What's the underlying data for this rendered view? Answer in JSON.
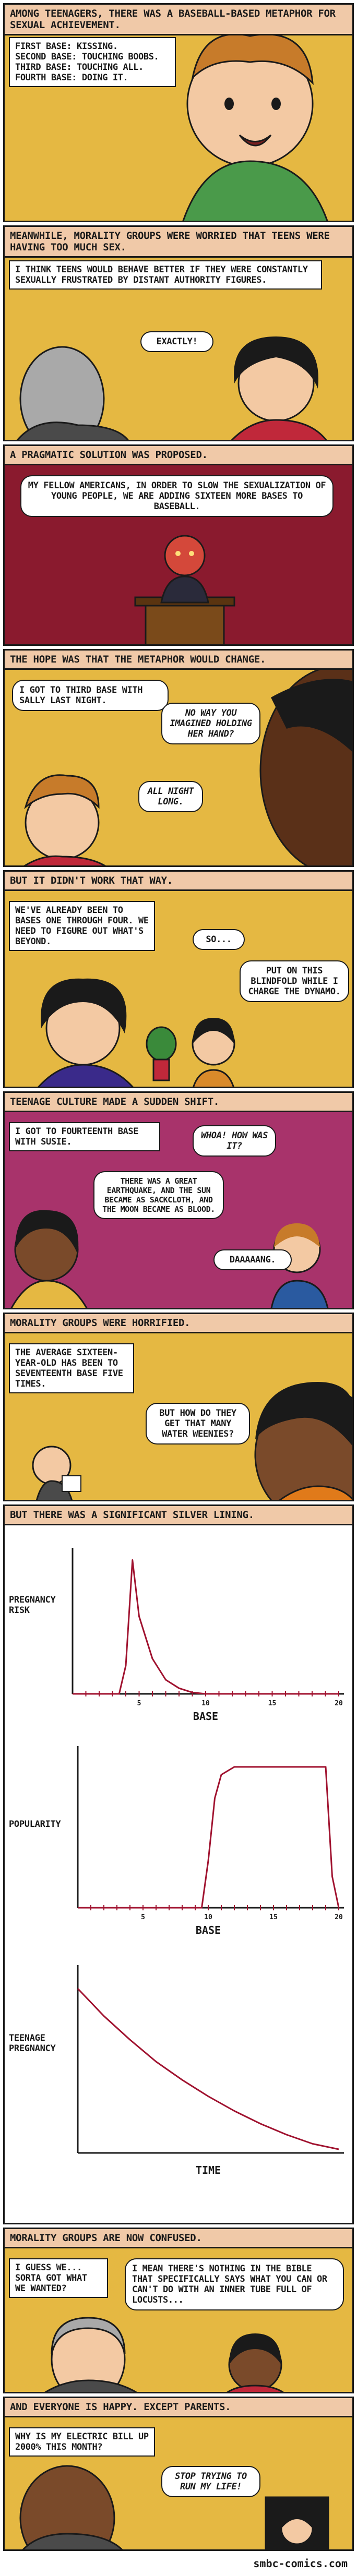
{
  "panels": [
    {
      "caption": "Among teenagers, there was a baseball-based metaphor for sexual achievement.",
      "box": "First base: Kissing.\nSecond base: Touching boobs.\nThird base: Touching ALL.\nFourth base: Doing it."
    },
    {
      "caption": "Meanwhile, morality groups were worried that teens were having too much sex.",
      "box": "I think teens would behave better if they were constantly sexually frustrated by distant authority figures.",
      "bubble": "Exactly!"
    },
    {
      "caption": "A pragmatic solution was proposed.",
      "box": "My fellow Americans, in order to slow the sexualization of young people, we are adding sixteen more bases to baseball."
    },
    {
      "caption": "The hope was that the metaphor would change.",
      "box": "I got to third base with Sally last night.",
      "bubble1": "No way you imagined holding her hand?",
      "bubble2": "All night long."
    },
    {
      "caption": "But it didn't work that way.",
      "box": "We've already been to bases one through four. We need to figure out what's beyond.",
      "bubble1": "So...",
      "bubble2": "Put on this blindfold while I charge the dynamo."
    },
    {
      "caption": "Teenage culture made a sudden shift.",
      "box": "I got to fourteenth base with Susie.",
      "bubble1": "Whoa! How was it?",
      "bubble2": "There was a great earthquake, and the sun became as sackcloth, and the moon became as blood.",
      "bubble3": "Daaaaang."
    },
    {
      "caption": "Morality groups were horrified.",
      "box": "The average sixteen-year-old has been to seventeenth base five times.",
      "bubble": "But how do they get that many water weenies?"
    },
    {
      "caption": "But there was a significant silver lining."
    },
    {
      "caption": "Morality groups are now confused.",
      "bubble1": "I guess we... sorta got what we wanted?",
      "bubble2": "I mean there's nothing in the Bible that specifically says what you can or can't do with an inner tube full of locusts..."
    },
    {
      "caption": "And everyone is happy. Except parents.",
      "box": "Why is my electric bill up 2000% this month?",
      "bubble": "Stop trying to run my life!"
    }
  ],
  "chart_data": [
    {
      "type": "line",
      "ylabel": "Pregnancy risk",
      "xlabel": "Base",
      "xticks": [
        5,
        10,
        15,
        20
      ],
      "xlim": [
        0,
        20
      ],
      "series": [
        {
          "x": [
            0,
            3.5,
            4.0,
            4.5,
            5,
            6,
            7,
            8,
            9,
            10,
            12,
            15,
            20
          ],
          "y": [
            0.0,
            0.0,
            0.2,
            0.95,
            0.55,
            0.25,
            0.1,
            0.04,
            0.01,
            0.0,
            0.0,
            0.0,
            0.0
          ]
        }
      ]
    },
    {
      "type": "line",
      "ylabel": "Popularity",
      "xlabel": "Base",
      "xticks": [
        5,
        10,
        15,
        20
      ],
      "xlim": [
        0,
        20
      ],
      "series": [
        {
          "x": [
            0,
            9.5,
            10,
            10.5,
            11,
            12,
            18,
            19,
            19.5,
            20
          ],
          "y": [
            0.0,
            0.0,
            0.3,
            0.7,
            0.85,
            0.9,
            0.9,
            0.9,
            0.2,
            0.0
          ]
        }
      ]
    },
    {
      "type": "line",
      "ylabel": "Teenage pregnancy",
      "xlabel": "Time",
      "series": [
        {
          "x": [
            0,
            1,
            2,
            3,
            4,
            5,
            6,
            7,
            8,
            9,
            10
          ],
          "y": [
            0.9,
            0.75,
            0.62,
            0.5,
            0.4,
            0.31,
            0.23,
            0.16,
            0.1,
            0.05,
            0.02
          ]
        }
      ]
    }
  ],
  "footer": "smbc-comics.com",
  "colors": {
    "caption_bg": "#f0c9a8",
    "panel_bg_yellow": "#e5b842",
    "panel_bg_crimson": "#8a1a2e",
    "panel_bg_magenta": "#a8336b",
    "curve": "#a0122f"
  }
}
